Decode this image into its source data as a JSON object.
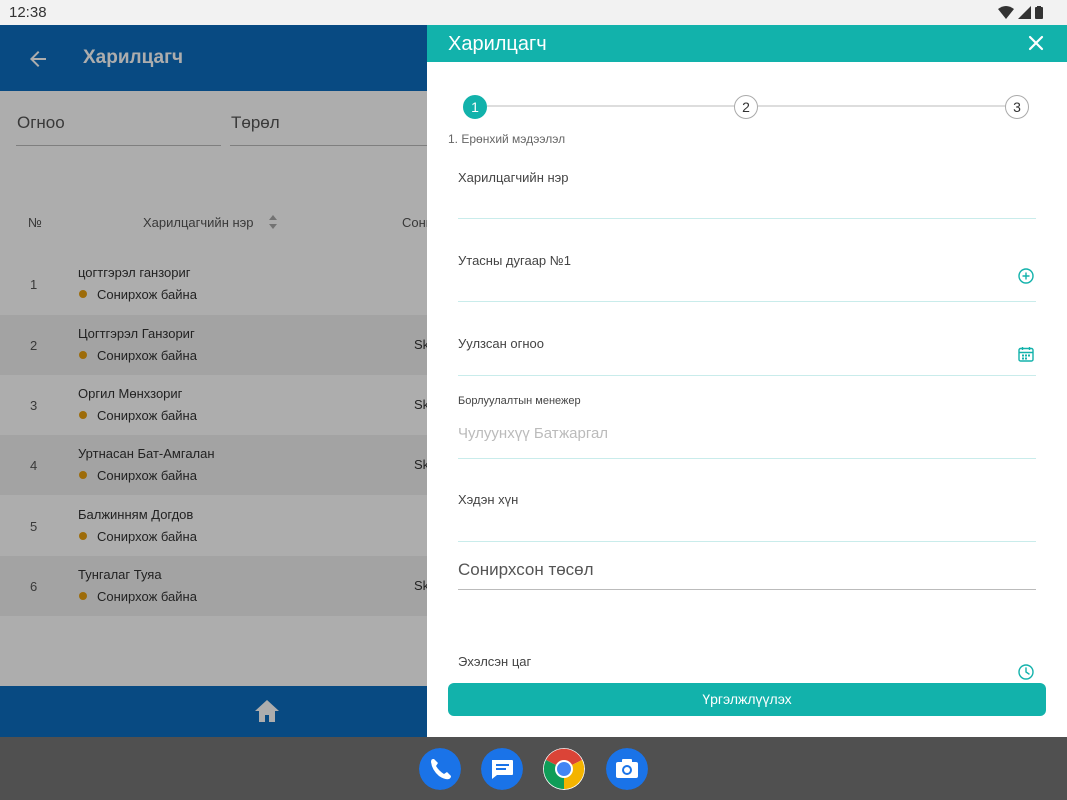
{
  "status_bar": {
    "time": "12:38",
    "icons": [
      "wifi-icon",
      "signal-icon",
      "battery-icon"
    ]
  },
  "background": {
    "title": "Харилцагч",
    "filters": {
      "date": "Огноо",
      "type": "Төрөл"
    },
    "columns": {
      "num": "№",
      "name": "Харилцагчийн нэр",
      "interest": "Сони"
    },
    "rows": [
      {
        "num": "1",
        "name": "цогтгэрэл  ганзориг",
        "status": "Сонирхож байна",
        "extra": ""
      },
      {
        "num": "2",
        "name": "Цогтгэрэл Ганзориг",
        "status": "Сонирхож байна",
        "extra": "Sk"
      },
      {
        "num": "3",
        "name": "Оргил Мөнхзориг",
        "status": "Сонирхож байна",
        "extra": "Sk"
      },
      {
        "num": "4",
        "name": "Уртнасан Бат-Амгалан",
        "status": "Сонирхож байна",
        "extra": "Sk"
      },
      {
        "num": "5",
        "name": "Балжинням Догдов",
        "status": "Сонирхож байна",
        "extra": ""
      },
      {
        "num": "6",
        "name": "Тунгалаг Туяа",
        "status": "Сонирхож байна",
        "extra": "Sk"
      }
    ]
  },
  "panel": {
    "title": "Харилцагч",
    "steps": [
      "1",
      "2",
      "3"
    ],
    "active_step": 1,
    "step_label": "1. Ерөнхий мэдээлэл",
    "fields": {
      "customer_name": {
        "label": "Харилцагчийн нэр"
      },
      "phone": {
        "label": "Утасны дугаар №1"
      },
      "meeting_date": {
        "label": "Уулзсан огноо"
      },
      "sales_manager": {
        "label": "Борлуулалтын менежер",
        "value": "Чулуунхүү Батжаргал"
      },
      "people_count": {
        "label": "Хэдэн хүн"
      },
      "project": {
        "label": "Сонирхсон төсөл"
      },
      "start_time": {
        "label": "Эхэлсэн цаг"
      }
    },
    "continue_label": "Үргэлжлүүлэх"
  },
  "dock": [
    "phone-app-icon",
    "messages-app-icon",
    "chrome-app-icon",
    "camera-app-icon"
  ],
  "colors": {
    "primary": "#0d6ec0",
    "accent": "#12b2ab",
    "status_dot": "#e8a00f"
  }
}
